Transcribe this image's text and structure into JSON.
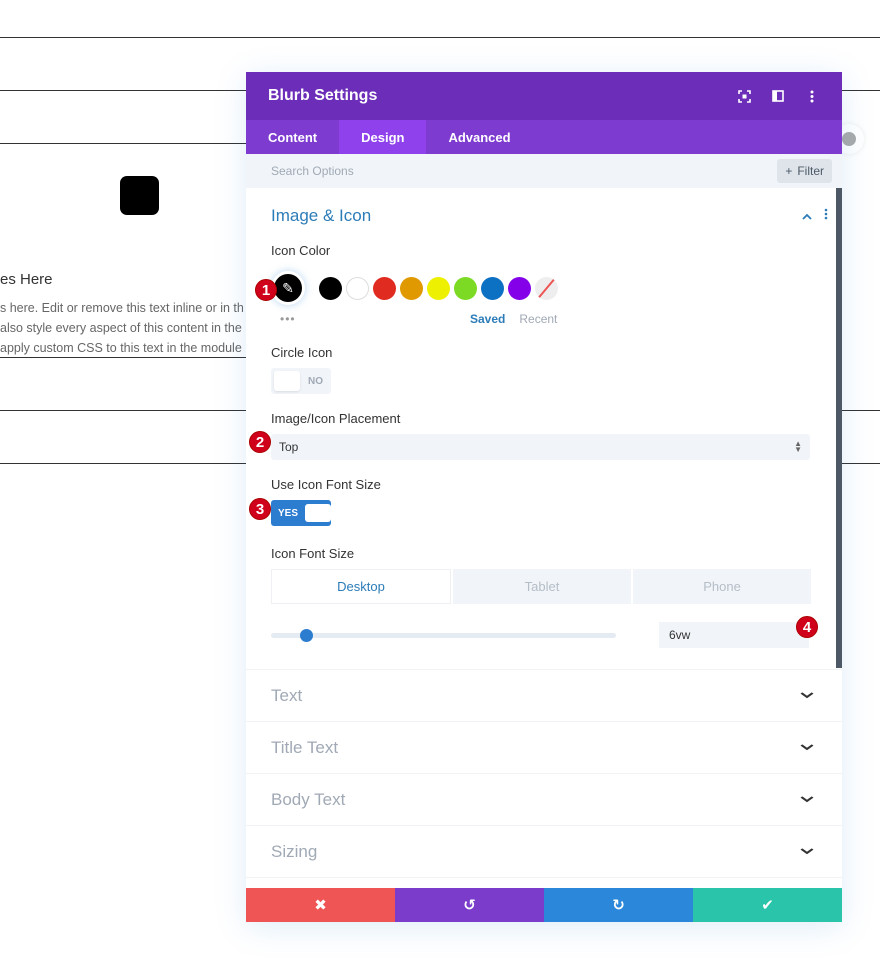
{
  "background": {
    "blurb_title_fragment": "es Here",
    "blurb_body_lines": [
      "s here. Edit or remove this text inline or in th",
      "also style every aspect of this content in the",
      " apply custom CSS to this text in the module"
    ]
  },
  "modal": {
    "title": "Blurb Settings",
    "header_icons": [
      "screenshot-icon",
      "split-view-icon",
      "more-vertical-icon"
    ],
    "tabs": [
      {
        "label": "Content",
        "active": false
      },
      {
        "label": "Design",
        "active": true
      },
      {
        "label": "Advanced",
        "active": false
      }
    ],
    "search": {
      "placeholder": "Search Options",
      "filter_label": "Filter",
      "filter_symbol": "+"
    },
    "section": {
      "title": "Image & Icon",
      "icon_color": {
        "label": "Icon Color",
        "selected": "#000000",
        "swatches": [
          "#000000",
          "#ffffff",
          "#e02b20",
          "#e09900",
          "#edf000",
          "#7cda24",
          "#0c71c3",
          "#8300e9",
          "none"
        ],
        "more": "•••",
        "saved_label": "Saved",
        "recent_label": "Recent"
      },
      "circle_icon": {
        "label": "Circle Icon",
        "value": "NO"
      },
      "placement": {
        "label": "Image/Icon Placement",
        "value": "Top"
      },
      "use_icon_font_size": {
        "label": "Use Icon Font Size",
        "value": "YES"
      },
      "icon_font_size": {
        "label": "Icon Font Size",
        "devices": [
          {
            "label": "Desktop",
            "active": true
          },
          {
            "label": "Tablet",
            "active": false
          },
          {
            "label": "Phone",
            "active": false
          }
        ],
        "value": "6vw",
        "slider_fraction": 0.06
      }
    },
    "collapsed_sections": [
      "Text",
      "Title Text",
      "Body Text",
      "Sizing"
    ],
    "badges": [
      "1",
      "2",
      "3",
      "4"
    ],
    "footer": {
      "cancel": {
        "symbol": "✖",
        "color": "#ef5555"
      },
      "undo": {
        "symbol": "↺",
        "color": "#7b3bcb"
      },
      "redo": {
        "symbol": "↻",
        "color": "#2b87da"
      },
      "save": {
        "symbol": "✔",
        "color": "#29c4a9"
      }
    }
  }
}
